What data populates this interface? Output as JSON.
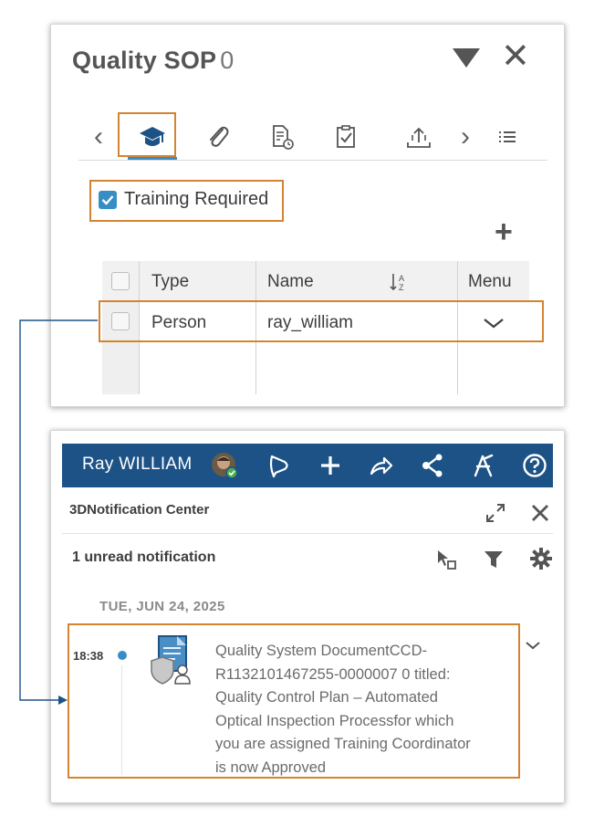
{
  "sop_panel": {
    "title": "Quality SOP",
    "revision": "0",
    "close_symbol": "✕",
    "tabs": [
      {
        "name": "prev-chevron",
        "icon": "chevron-left-icon",
        "glyph": "‹"
      },
      {
        "name": "training",
        "icon": "graduation-cap-icon",
        "active": true
      },
      {
        "name": "attachments",
        "icon": "paperclip-icon"
      },
      {
        "name": "document-history",
        "icon": "document-clock-icon"
      },
      {
        "name": "approvals",
        "icon": "clipboard-check-icon"
      },
      {
        "name": "share",
        "icon": "upload-share-icon"
      },
      {
        "name": "next-chevron",
        "icon": "chevron-right-icon",
        "glyph": "›"
      },
      {
        "name": "list",
        "icon": "list-icon"
      }
    ],
    "training_required": {
      "label": "Training Required",
      "checked": true
    },
    "add_symbol": "+",
    "table": {
      "columns": [
        "Type",
        "Name",
        "Menu"
      ],
      "rows": [
        {
          "type": "Person",
          "name": "ray_william"
        }
      ]
    }
  },
  "notification_panel": {
    "topbar": {
      "user_name": "Ray WILLIAM",
      "icons": [
        "avatar",
        "chat-bubble-icon",
        "plus-icon",
        "share-arrow-icon",
        "network-share-icon",
        "compass-tool-icon",
        "help-icon"
      ]
    },
    "title": "3DNotification Center",
    "unread_label": "1 unread notification",
    "date_header": "TUE, JUN 24, 2025",
    "notification": {
      "time": "18:38",
      "lines": [
        "Quality System DocumentCCD-",
        "R1132101467255-0000007 0 titled:",
        "Quality Control Plan – Automated",
        "Optical Inspection Processfor which",
        "you are assigned Training Coordinator",
        "is now Approved"
      ]
    }
  },
  "colors": {
    "accent_blue": "#368ec4",
    "topbar_blue": "#1d5287",
    "highlight_orange": "#d48431",
    "connector_blue": "#1d5287"
  }
}
